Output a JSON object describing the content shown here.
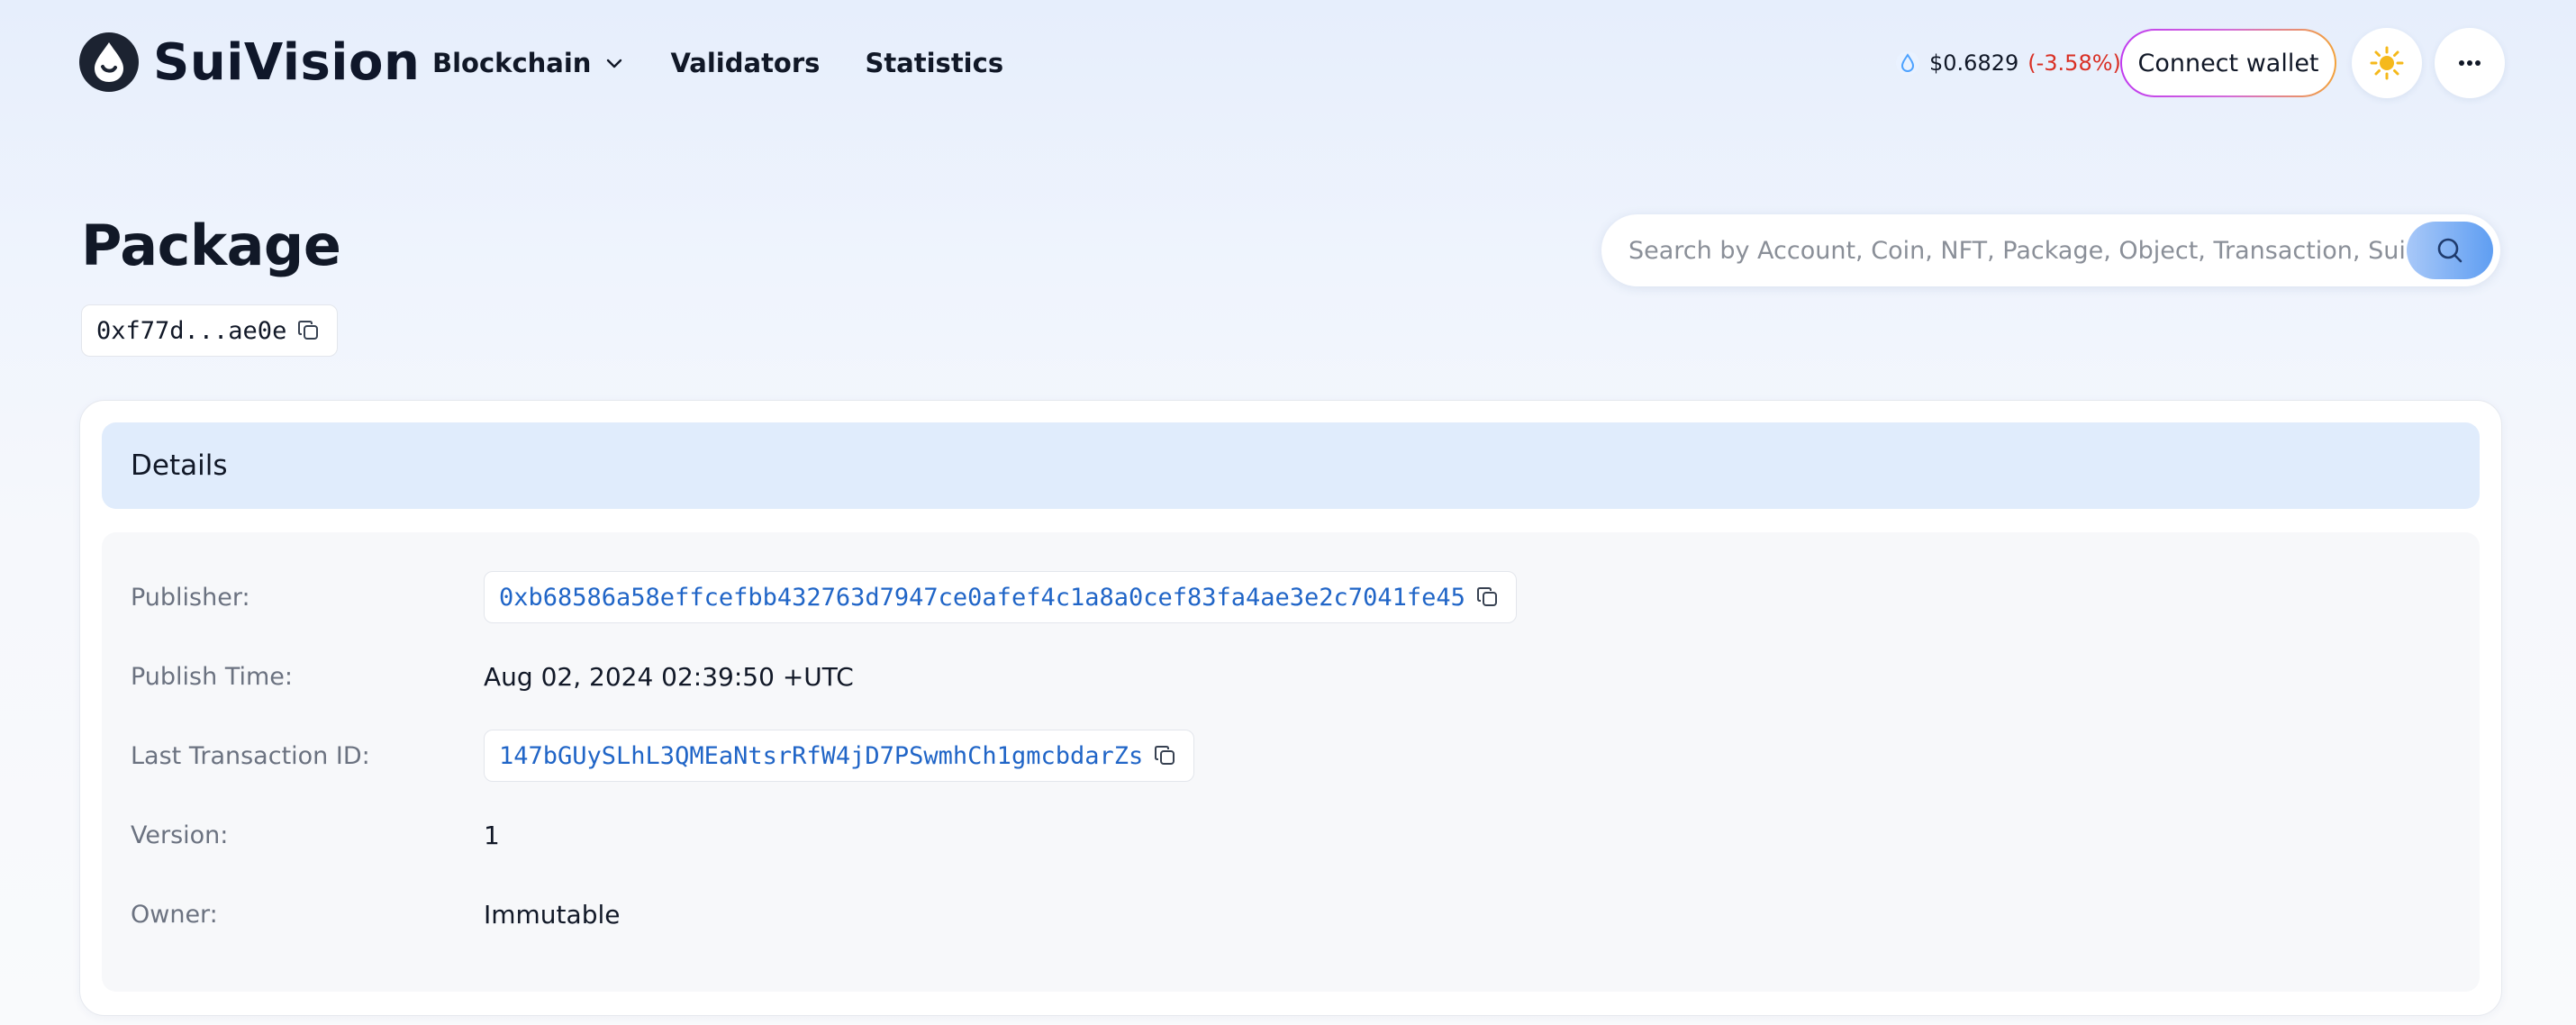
{
  "brand": {
    "name": "SuiVision"
  },
  "nav": {
    "items": [
      {
        "label": "Blockchain",
        "has_dropdown": true
      },
      {
        "label": "Validators"
      },
      {
        "label": "Statistics"
      }
    ]
  },
  "token": {
    "price": "$0.6829",
    "change": "(-3.58%)",
    "change_color": "#d93025"
  },
  "actions": {
    "connect_label": "Connect wallet",
    "theme_icon": "sun-icon",
    "more_icon": "more-horizontal-icon"
  },
  "page": {
    "title": "Package",
    "address_short": "0xf77d...ae0e"
  },
  "search": {
    "placeholder": "Search by Account, Coin, NFT, Package, Object, Transaction, SuiNS"
  },
  "details": {
    "title": "Details",
    "rows": [
      {
        "label": "Publisher:",
        "value": "0xb68586a58effcefbb432763d7947ce0afef4c1a8a0cef83fa4ae3e2c7041fe45",
        "type": "link"
      },
      {
        "label": "Publish Time:",
        "value": "Aug 02, 2024 02:39:50 +UTC",
        "type": "text"
      },
      {
        "label": "Last Transaction ID:",
        "value": "147bGUySLhL3QMEaNtsrRfW4jD7PSwmhCh1gmcbdarZs",
        "type": "link"
      },
      {
        "label": "Version:",
        "value": "1",
        "type": "text"
      },
      {
        "label": "Owner:",
        "value": "Immutable",
        "type": "text"
      }
    ]
  },
  "colors": {
    "link": "#2065c7",
    "accent_header": "#e0ecfc"
  }
}
